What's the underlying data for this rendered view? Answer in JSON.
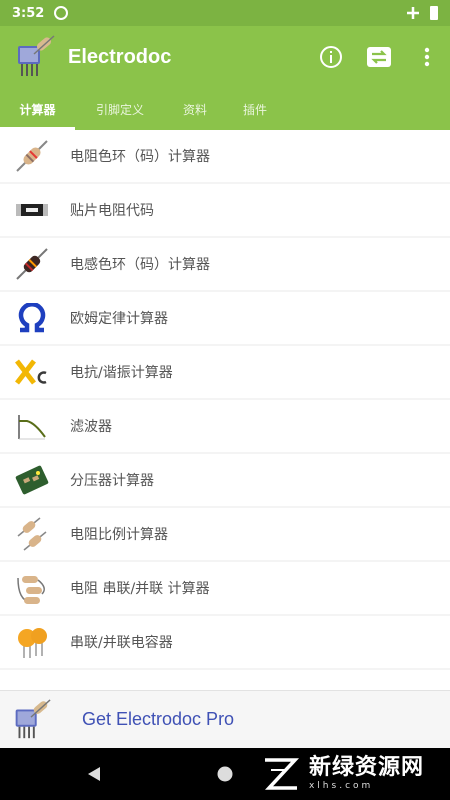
{
  "status": {
    "time": "3:52"
  },
  "app": {
    "title": "Electrodoc"
  },
  "tabs": [
    {
      "label": "计算器",
      "active": true
    },
    {
      "label": "引脚定义",
      "active": false
    },
    {
      "label": "资料",
      "active": false
    },
    {
      "label": "插件",
      "active": false
    }
  ],
  "list": [
    {
      "label": "电阻色环（码）计算器",
      "icon": "resistor-icon"
    },
    {
      "label": "贴片电阻代码",
      "icon": "smd-resistor-icon"
    },
    {
      "label": "电感色环（码）计算器",
      "icon": "inductor-icon"
    },
    {
      "label": "欧姆定律计算器",
      "icon": "ohm-icon"
    },
    {
      "label": "电抗/谐振计算器",
      "icon": "reactance-icon"
    },
    {
      "label": "滤波器",
      "icon": "filter-icon"
    },
    {
      "label": "分压器计算器",
      "icon": "divider-board-icon"
    },
    {
      "label": "电阻比例计算器",
      "icon": "resistor-ratio-icon"
    },
    {
      "label": "电阻 串联/并联 计算器",
      "icon": "resistor-series-parallel-icon"
    },
    {
      "label": "串联/并联电容器",
      "icon": "capacitor-icon"
    }
  ],
  "promo": {
    "label": "Get Electrodoc Pro"
  },
  "watermark": {
    "brand": "新绿资源网",
    "domain": "xlhs.com"
  },
  "colors": {
    "primary": "#8bc34a",
    "status": "#7cb342",
    "link": "#3f51b5"
  }
}
